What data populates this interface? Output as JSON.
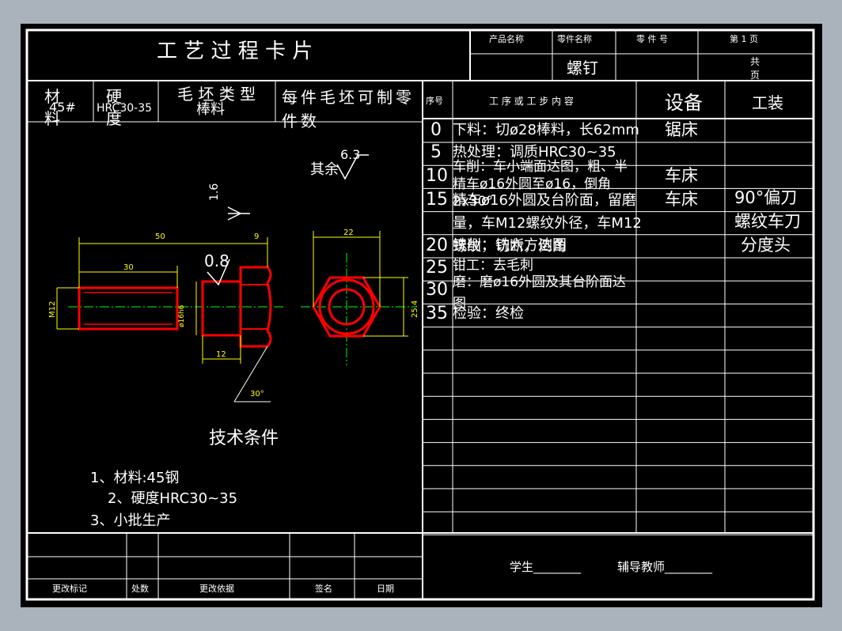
{
  "card": {
    "title": "工 艺 过 程 卡 片",
    "product_name_label": "产品名称",
    "part_name_label": "零件名称",
    "part_no_label": "零 件 号",
    "page_label": "第 1 页",
    "part_name": "螺钉",
    "total_pages_label": "共\n页"
  },
  "material_row": {
    "material_label": "材料",
    "material_value": "45#",
    "hardness_label": "硬度",
    "hardness_value": "HRC30-35",
    "blank_type_label": "毛 坯 类 型",
    "blank_type_value": "棒料",
    "per_blank_label": "每件毛坯可制零件数"
  },
  "process_table": {
    "headers": [
      "序号",
      "工 序 或 工 步 内 容",
      "设备",
      "工装"
    ],
    "rows": [
      {
        "no": "0",
        "content": "下料：切ø28棒料，长62mm",
        "equipment": "锯床",
        "tooling": ""
      },
      {
        "no": "5",
        "content": "热处理：调质HRC30~35",
        "equipment": "",
        "tooling": ""
      },
      {
        "no": "10",
        "content": "车削：车小端面达图，粗、半精车ø16外圆至ø16，倒角2x30°",
        "equipment": "车床",
        "tooling": ""
      },
      {
        "no": "15",
        "content": "精车ø16外圆及台阶面，留磨量，车M12螺纹外径，车M12螺纹，切断，倒角",
        "equipment": "车床",
        "tooling": "90°偏刀"
      },
      {
        "no": "",
        "content": "",
        "equipment": "",
        "tooling": "螺纹车刀"
      },
      {
        "no": "20",
        "content": "铣削：铣六方达图",
        "equipment": "",
        "tooling": "分度头"
      },
      {
        "no": "25",
        "content": "钳工：去毛刺",
        "equipment": "",
        "tooling": ""
      },
      {
        "no": "30",
        "content": "磨：磨ø16外圆及其台阶面达图",
        "equipment": "",
        "tooling": ""
      },
      {
        "no": "35",
        "content": "检验：终检",
        "equipment": "",
        "tooling": ""
      }
    ]
  },
  "drawing": {
    "roughness_general_prefix": "其余",
    "roughness_general": "6.3",
    "roughness_a": "1.6",
    "roughness_b": "0.8",
    "dim_50": "50",
    "dim_9": "9",
    "dim_30": "30",
    "dim_12": "12",
    "dim_m12": "M12",
    "dim_d16": "ø16h6",
    "dim_30deg": "30°",
    "dim_22": "22",
    "dim_25_4": "25.4",
    "tech_title": "技术条件",
    "tech_items": [
      "1、材料:45钢",
      "2、硬度HRC30~35",
      "3、小批生产"
    ]
  },
  "revision": {
    "labels": [
      "更改标记",
      "处数",
      "更改依据",
      "签名",
      "日期"
    ]
  },
  "signature": {
    "student_label": "学生________",
    "teacher_label": "辅导教师________"
  },
  "colors": {
    "background": "#000000",
    "line": "#ffffff",
    "outline": "#ff0000",
    "dimension": "#ffff00",
    "centerline": "#00ff00",
    "surround": "#aab2bc"
  }
}
